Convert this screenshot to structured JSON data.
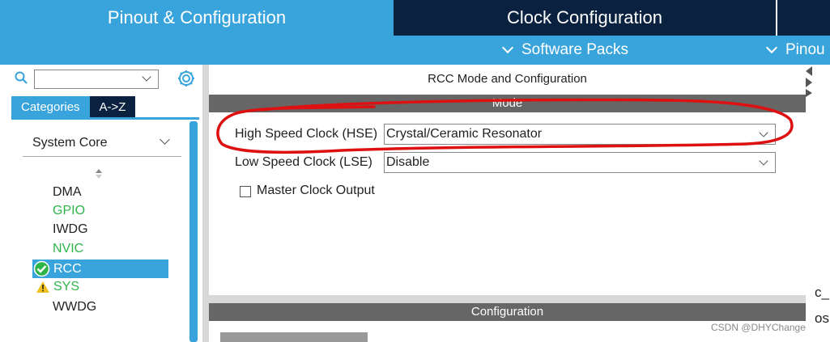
{
  "top_tabs": {
    "pinout_label": "Pinout & Configuration",
    "clock_label": "Clock Configuration"
  },
  "subbar": {
    "software_packs": "Software Packs",
    "pinout": "Pinou"
  },
  "left": {
    "categories_tab": "Categories",
    "az_tab": "A->Z",
    "group": "System Core",
    "items": [
      "DMA",
      "GPIO",
      "IWDG",
      "NVIC",
      "RCC",
      "SYS",
      "WWDG"
    ]
  },
  "right": {
    "title": "RCC Mode and Configuration",
    "mode_header": "Mode",
    "hse_label": "High Speed Clock (HSE)",
    "hse_value": "Crystal/Ceramic Resonator",
    "lse_label": "Low Speed Clock (LSE)",
    "lse_value": "Disable",
    "mco_label": "Master Clock Output",
    "config_header": "Configuration"
  },
  "edge": {
    "text1": "c_",
    "text2": "os"
  },
  "watermark": "CSDN @DHYChange",
  "colors": {
    "accent": "#39a3dc",
    "dark_navy": "#0a2240",
    "green_item": "#2fb44a",
    "section_bar": "#666666",
    "annotation_red": "#d11"
  }
}
